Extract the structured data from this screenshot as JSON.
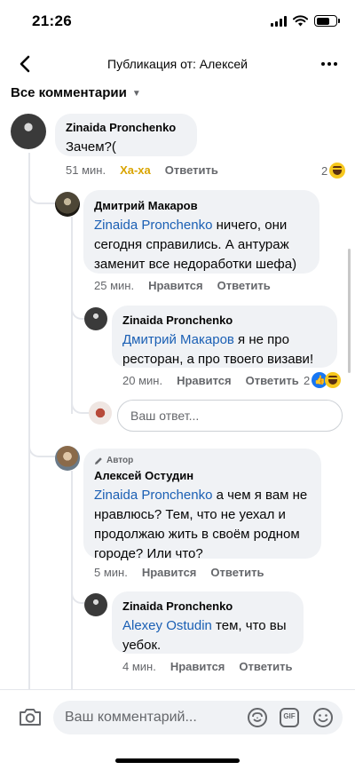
{
  "status_bar": {
    "time": "21:26",
    "battery_level": 0.7
  },
  "header": {
    "title": "Публикация от: Алексей"
  },
  "filter": {
    "label": "Все комментарии"
  },
  "comments": [
    {
      "author": "Zinaida Pronchenko",
      "text": "Зачем?(",
      "time": "51 мин.",
      "reaction_label": "Ха-ха",
      "reply_label": "Ответить",
      "reaction_count": "2"
    },
    {
      "author": "Дмитрий Макаров",
      "mention": "Zinaida Pronchenko",
      "text": " ничего, они сегодня справились. А антураж заменит все недоработки шефа)",
      "time": "25 мин.",
      "like_label": "Нравится",
      "reply_label": "Ответить"
    },
    {
      "author": "Zinaida Pronchenko",
      "mention": "Дмитрий Макаров",
      "text": " я не про ресторан, а про твоего визави!",
      "time": "20 мин.",
      "like_label": "Нравится",
      "reply_label": "Ответить",
      "reaction_count": "2"
    },
    {
      "badge": "Автор",
      "author": "Алексей Остудин",
      "mention": "Zinaida Pronchenko",
      "text": " а чем я вам не нравлюсь? Тем, что не уехал и продолжаю жить в своём родном городе? Или что?",
      "time": "5 мин.",
      "like_label": "Нравится",
      "reply_label": "Ответить"
    },
    {
      "author": "Zinaida Pronchenko",
      "mention": "Alexey Ostudin",
      "text": " тем, что вы уебок.",
      "time": "4 мин.",
      "like_label": "Нравится",
      "reply_label": "Ответить"
    }
  ],
  "reply_input": {
    "placeholder": "Ваш ответ..."
  },
  "bottom_bar": {
    "placeholder": "Ваш комментарий...",
    "gif_label": "GIF"
  }
}
